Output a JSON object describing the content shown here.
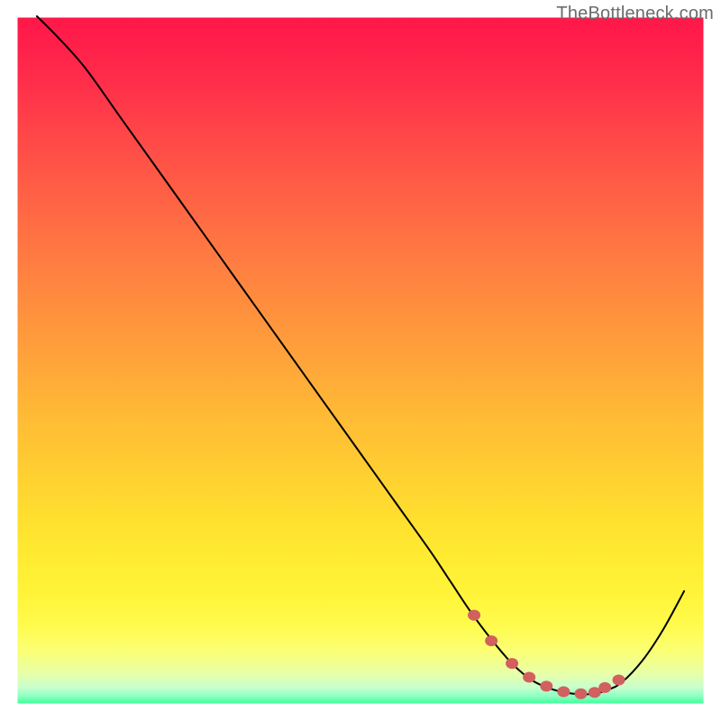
{
  "watermark": "TheBottleneck.com",
  "chart_data": {
    "type": "line",
    "title": "",
    "xlabel": "",
    "ylabel": "",
    "xlim": [
      0,
      100
    ],
    "ylim": [
      0,
      100
    ],
    "background_gradient": {
      "stops": [
        {
          "offset": 0.0,
          "color": "#ff1749"
        },
        {
          "offset": 0.04,
          "color": "#ff1f4a"
        },
        {
          "offset": 0.1,
          "color": "#ff2f4a"
        },
        {
          "offset": 0.18,
          "color": "#ff4948"
        },
        {
          "offset": 0.26,
          "color": "#ff6145"
        },
        {
          "offset": 0.34,
          "color": "#ff7842"
        },
        {
          "offset": 0.42,
          "color": "#ff8e3e"
        },
        {
          "offset": 0.5,
          "color": "#ffa43a"
        },
        {
          "offset": 0.58,
          "color": "#ffba35"
        },
        {
          "offset": 0.66,
          "color": "#ffce31"
        },
        {
          "offset": 0.72,
          "color": "#ffdd2f"
        },
        {
          "offset": 0.78,
          "color": "#ffea30"
        },
        {
          "offset": 0.84,
          "color": "#fff439"
        },
        {
          "offset": 0.885,
          "color": "#fffb4d"
        },
        {
          "offset": 0.92,
          "color": "#fcff72"
        },
        {
          "offset": 0.955,
          "color": "#e7ffa8"
        },
        {
          "offset": 0.975,
          "color": "#c7ffcf"
        },
        {
          "offset": 0.988,
          "color": "#8bffc1"
        },
        {
          "offset": 1.0,
          "color": "#2dff92"
        }
      ]
    },
    "series": [
      {
        "name": "bottleneck-curve",
        "color": "#000000",
        "width": 2,
        "x": [
          3,
          6,
          10,
          15,
          20,
          25,
          30,
          35,
          40,
          45,
          50,
          55,
          60,
          63,
          66,
          69,
          72,
          75,
          78,
          81,
          84,
          86,
          88,
          91,
          94,
          97
        ],
        "y": [
          100,
          97,
          92.5,
          85.5,
          78.5,
          71.5,
          64.5,
          57.5,
          50.5,
          43.5,
          36.5,
          29.5,
          22.5,
          18,
          13.5,
          9.5,
          6,
          3.5,
          2.2,
          1.6,
          1.6,
          2.2,
          3.3,
          6.5,
          11,
          16.5
        ]
      },
      {
        "name": "optimal-zone-markers",
        "type": "scatter",
        "color": "#d1605e",
        "radius": 6,
        "x": [
          66.5,
          69,
          72,
          74.5,
          77,
          79.5,
          82,
          84,
          85.5,
          87.5
        ],
        "y": [
          13.0,
          9.3,
          6.0,
          4.0,
          2.7,
          1.9,
          1.6,
          1.8,
          2.5,
          3.6
        ]
      }
    ]
  }
}
